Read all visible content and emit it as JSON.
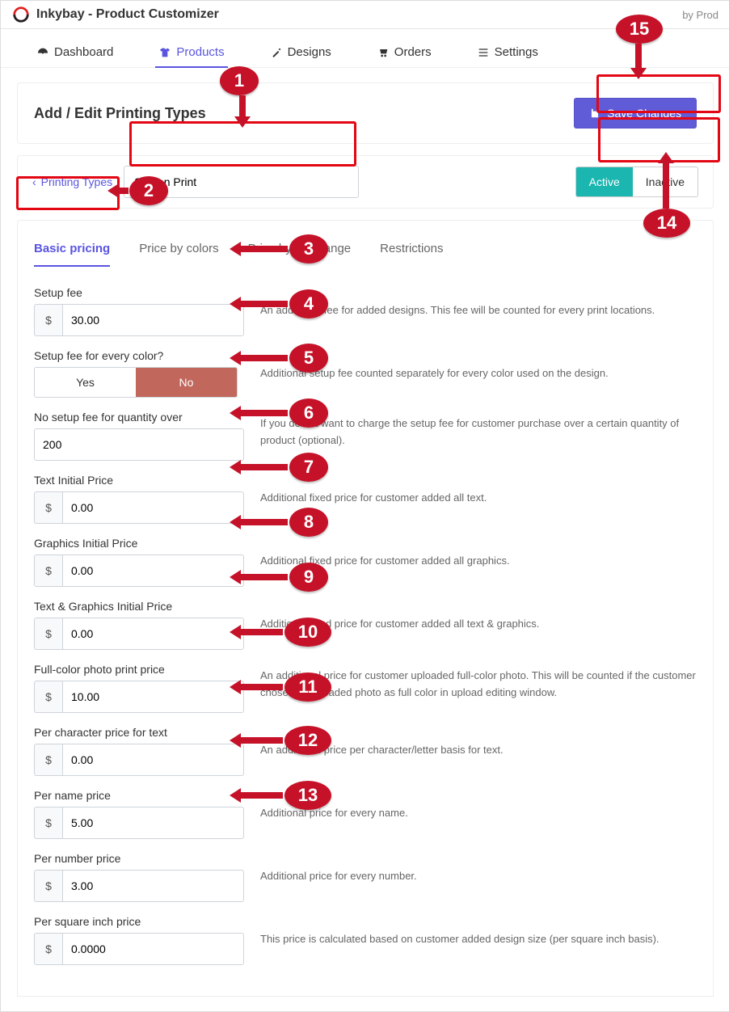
{
  "header": {
    "app_name": "Inkybay - Product Customizer",
    "byline": "by Prod"
  },
  "nav": {
    "dashboard": "Dashboard",
    "products": "Products",
    "designs": "Designs",
    "orders": "Orders",
    "settings": "Settings"
  },
  "page": {
    "title": "Add / Edit Printing Types",
    "save": "Save Changes",
    "back": "Printing Types",
    "name_value": "Screen Print",
    "status": {
      "active": "Active",
      "inactive": "Inactive"
    },
    "tabs": {
      "basic": "Basic pricing",
      "colors": "Price by colors",
      "size": "Price by size range",
      "restrictions": "Restrictions"
    },
    "currency": "$",
    "fields": {
      "setup_fee": {
        "label": "Setup fee",
        "value": "30.00",
        "help": "An additional fee for added designs. This fee will be counted for every print locations."
      },
      "setup_fee_per_color": {
        "label": "Setup fee for every color?",
        "yes": "Yes",
        "no": "No",
        "help": "Additional setup fee counted separately for every color used on the design."
      },
      "no_setup_over": {
        "label": "No setup fee for quantity over",
        "value": "200",
        "help": "If you do not want to charge the setup fee for customer purchase over a certain quantity of product (optional)."
      },
      "text_initial": {
        "label": "Text Initial Price",
        "value": "0.00",
        "help": "Additional fixed price for customer added all text."
      },
      "graphics_initial": {
        "label": "Graphics Initial Price",
        "value": "0.00",
        "help": "Additional fixed price for customer added all graphics."
      },
      "textgfx_initial": {
        "label": "Text & Graphics Initial Price",
        "value": "0.00",
        "help": "Additional fixed price for customer added all text & graphics."
      },
      "photo_price": {
        "label": "Full-color photo print price",
        "value": "10.00",
        "help": "An additional price for customer uploaded full-color photo. This will be counted if the customer chose the uploaded photo as full color in upload editing window."
      },
      "per_char": {
        "label": "Per character price for text",
        "value": "0.00",
        "help": "An additional price per character/letter basis for text."
      },
      "per_name": {
        "label": "Per name price",
        "value": "5.00",
        "help": "Additional price for every name."
      },
      "per_number": {
        "label": "Per number price",
        "value": "3.00",
        "help": "Additional price for every number."
      },
      "per_sqin": {
        "label": "Per square inch price",
        "value": "0.0000",
        "help": "This price is calculated based on customer added design size (per square inch basis)."
      }
    }
  },
  "annotations": [
    "1",
    "2",
    "3",
    "4",
    "5",
    "6",
    "7",
    "8",
    "9",
    "10",
    "11",
    "12",
    "13",
    "14",
    "15"
  ]
}
